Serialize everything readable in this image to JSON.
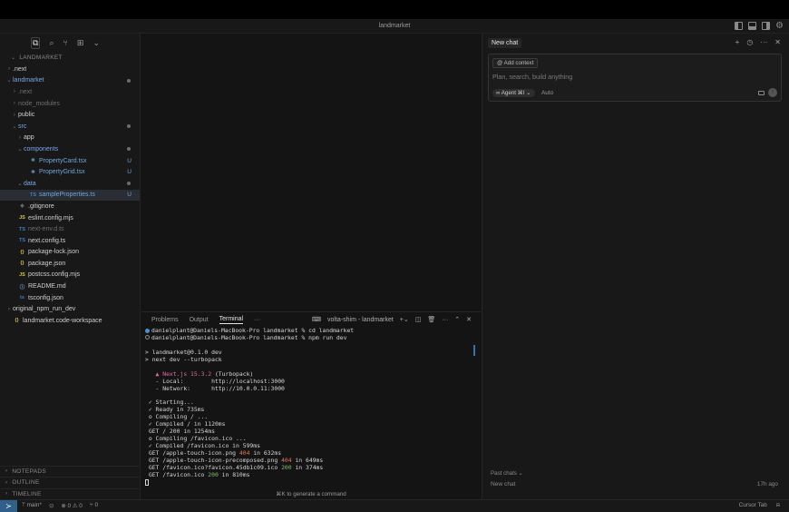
{
  "window": {
    "title": "landmarket"
  },
  "explorer": {
    "root": "LANDMARKET",
    "rows": [
      {
        "label": ".next",
        "chev": "›",
        "icon": "",
        "indent": 0,
        "status": "",
        "dim": false
      },
      {
        "label": "landmarket",
        "chev": "⌄",
        "icon": "",
        "indent": 0,
        "status": "dot",
        "color": "green"
      },
      {
        "label": ".next",
        "chev": "›",
        "icon": "",
        "indent": 1,
        "status": "",
        "dim": true
      },
      {
        "label": "node_modules",
        "chev": "›",
        "icon": "",
        "indent": 1,
        "status": "",
        "dim": true
      },
      {
        "label": "public",
        "chev": "›",
        "icon": "",
        "indent": 1,
        "status": ""
      },
      {
        "label": "src",
        "chev": "⌄",
        "icon": "",
        "indent": 1,
        "status": "dot",
        "color": "green"
      },
      {
        "label": "app",
        "chev": "›",
        "icon": "",
        "indent": 2,
        "status": ""
      },
      {
        "label": "components",
        "chev": "⌄",
        "icon": "",
        "indent": 2,
        "status": "dot",
        "color": "green"
      },
      {
        "label": "PropertyCard.tsx",
        "chev": "",
        "icon": "⚛",
        "indent": 3,
        "status": "U",
        "color": "green"
      },
      {
        "label": "PropertyGrid.tsx",
        "chev": "",
        "icon": "⚛",
        "indent": 3,
        "status": "U",
        "color": "green"
      },
      {
        "label": "data",
        "chev": "⌄",
        "icon": "",
        "indent": 2,
        "status": "dot",
        "color": "green"
      },
      {
        "label": "sampleProperties.ts",
        "chev": "",
        "icon": "TS",
        "indent": 3,
        "status": "U",
        "color": "green",
        "selected": true
      },
      {
        "label": ".gitignore",
        "chev": "",
        "icon": "◈",
        "indent": 1,
        "status": ""
      },
      {
        "label": "eslint.config.mjs",
        "chev": "",
        "icon": "JS",
        "indent": 1,
        "status": ""
      },
      {
        "label": "next-env.d.ts",
        "chev": "",
        "icon": "TS",
        "indent": 1,
        "status": "",
        "dim": true
      },
      {
        "label": "next.config.ts",
        "chev": "",
        "icon": "TS",
        "indent": 1,
        "status": ""
      },
      {
        "label": "package-lock.json",
        "chev": "",
        "icon": "{}",
        "indent": 1,
        "status": ""
      },
      {
        "label": "package.json",
        "chev": "",
        "icon": "{}",
        "indent": 1,
        "status": ""
      },
      {
        "label": "postcss.config.mjs",
        "chev": "",
        "icon": "JS",
        "indent": 1,
        "status": ""
      },
      {
        "label": "README.md",
        "chev": "",
        "icon": "ⓘ",
        "indent": 1,
        "status": ""
      },
      {
        "label": "tsconfig.json",
        "chev": "",
        "icon": "ts",
        "indent": 1,
        "status": ""
      },
      {
        "label": "original_npm_run_dev",
        "chev": "›",
        "icon": "",
        "indent": 0,
        "status": ""
      },
      {
        "label": "landmarket.code-workspace",
        "chev": "",
        "icon": "{}",
        "indent": 0,
        "status": ""
      }
    ],
    "bottom_sections": [
      "NOTEPADS",
      "OUTLINE",
      "TIMELINE"
    ]
  },
  "panel": {
    "tabs": [
      "Problems",
      "Output",
      "Terminal"
    ],
    "active_tab": "Terminal",
    "more": "···",
    "terminal_name": "volta-shim - landmarket",
    "hint": "⌘K to generate a command"
  },
  "terminal": {
    "line1": "danielplant@Daniels-MacBook-Pro landmarket % cd landmarket",
    "line2": "danielplant@Daniels-MacBook-Pro landmarket % npm run dev",
    "l3": "> landmarket@0.1.0 dev",
    "l4": "> next dev --turbopack",
    "next_name": "▲ Next.js 15.3.2",
    "next_suffix": " (Turbopack)",
    "local": "   - Local:        http://localhost:3000",
    "network": "   - Network:      http://10.0.0.11:3000",
    "starting": " ✓ Starting...",
    "ready": " ✓ Ready in 735ms",
    "compiling": " o Compiling / ...",
    "compiled": " ✓ Compiled / in 1120ms",
    "get1": " GET / 200 in 1254ms",
    "compiling_fav": " o Compiling /favicon.ico ...",
    "compiled_fav": " ✓ Compiled /favicon.ico in 599ms",
    "get2a": " GET /apple-touch-icon.png ",
    "get2code": "404",
    "get2b": " in 632ms",
    "get3a": " GET /apple-touch-icon-precomposed.png ",
    "get3code": "404",
    "get3b": " in 649ms",
    "get4a": " GET /favicon.ico?favicon.45db1c09.ico ",
    "get4code": "200",
    "get4b": " in 374ms",
    "get5a": " GET /favicon.ico ",
    "get5code": "200",
    "get5b": " in 810ms"
  },
  "chat": {
    "tab": "New chat",
    "add_context": "@ Add context",
    "placeholder": "Plan, search, build anything",
    "agent": "∞ Agent ⌘I ⌄",
    "auto": "Auto",
    "past_chats": "Past chats ⌄",
    "past_item": "New chat",
    "past_time": "17h ago"
  },
  "statusbar": {
    "branch": "ᛘ main*",
    "sync": "⊙",
    "errors": "⊗ 0 ⚠ 0",
    "ports": "⑂ 0",
    "cursor_tab": "Cursor Tab",
    "bell": "🔔"
  }
}
